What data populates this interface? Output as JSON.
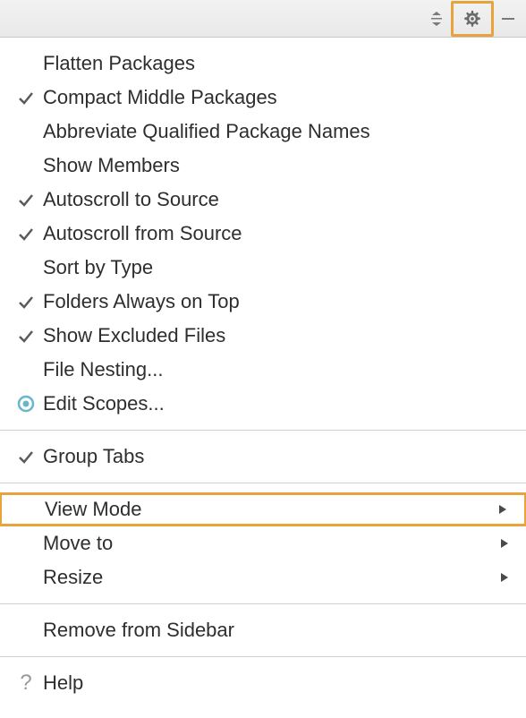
{
  "toolbar": {
    "collapse_icon": "collapse",
    "gear_icon": "gear",
    "minimize_icon": "minimize"
  },
  "menu": {
    "sections": [
      {
        "items": [
          {
            "label": "Flatten Packages",
            "checked": false,
            "submenu": false,
            "radio": false
          },
          {
            "label": "Compact Middle Packages",
            "checked": true,
            "submenu": false,
            "radio": false
          },
          {
            "label": "Abbreviate Qualified Package Names",
            "checked": false,
            "submenu": false,
            "radio": false
          },
          {
            "label": "Show Members",
            "checked": false,
            "submenu": false,
            "radio": false
          },
          {
            "label": "Autoscroll to Source",
            "checked": true,
            "submenu": false,
            "radio": false
          },
          {
            "label": "Autoscroll from Source",
            "checked": true,
            "submenu": false,
            "radio": false
          },
          {
            "label": "Sort by Type",
            "checked": false,
            "submenu": false,
            "radio": false
          },
          {
            "label": "Folders Always on Top",
            "checked": true,
            "submenu": false,
            "radio": false
          },
          {
            "label": "Show Excluded Files",
            "checked": true,
            "submenu": false,
            "radio": false
          },
          {
            "label": "File Nesting...",
            "checked": false,
            "submenu": false,
            "radio": false
          },
          {
            "label": "Edit Scopes...",
            "checked": false,
            "submenu": false,
            "radio": true
          }
        ]
      },
      {
        "items": [
          {
            "label": "Group Tabs",
            "checked": true,
            "submenu": false,
            "radio": false
          }
        ]
      },
      {
        "items": [
          {
            "label": "View Mode",
            "checked": false,
            "submenu": true,
            "radio": false,
            "highlighted": true
          },
          {
            "label": "Move to",
            "checked": false,
            "submenu": true,
            "radio": false
          },
          {
            "label": "Resize",
            "checked": false,
            "submenu": true,
            "radio": false
          }
        ]
      },
      {
        "items": [
          {
            "label": "Remove from Sidebar",
            "checked": false,
            "submenu": false,
            "radio": false
          }
        ]
      },
      {
        "items": [
          {
            "label": "Help",
            "checked": false,
            "submenu": false,
            "radio": false,
            "help": true
          }
        ]
      }
    ]
  }
}
